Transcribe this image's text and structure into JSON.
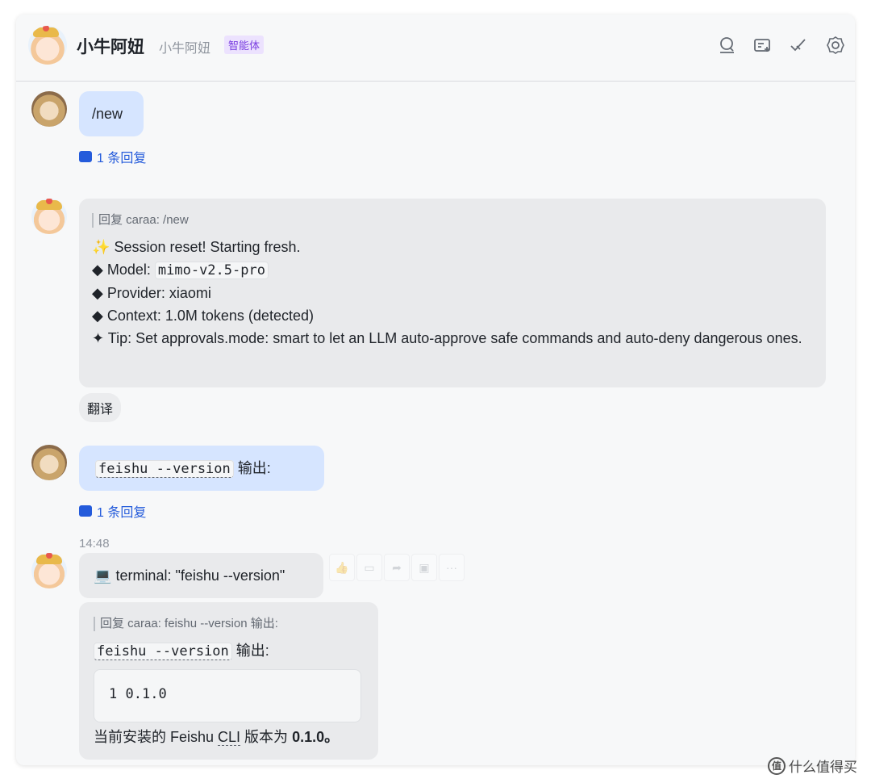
{
  "header": {
    "title": "小牛阿妞",
    "subtitle": "小牛阿妞",
    "badge": "智能体",
    "icons": [
      "search-icon",
      "add-tab-icon",
      "checkmark-icon",
      "gear-icon"
    ]
  },
  "messages": {
    "m1": {
      "text": "/new",
      "reply_count_label": "1 条回复"
    },
    "m2": {
      "quote": "回复 caraa:  /new",
      "line1_emoji": "✨",
      "line1": "Session reset! Starting fresh.",
      "model_prefix": "◆ Model:",
      "model_value": "mimo-v2.5-pro",
      "provider": "◆ Provider: xiaomi",
      "context": "◆ Context: 1.0M tokens (detected)",
      "tip": "✦ Tip: Set approvals.mode: smart to let an LLM auto-approve safe commands and auto-deny dangerous ones.",
      "translate_label": "翻译"
    },
    "m3": {
      "code": "feishu --version",
      "suffix": "输出:",
      "reply_count_label": "1 条回复"
    },
    "m4": {
      "time": "14:48",
      "emoji": "💻",
      "text": "terminal: \"feishu --version\"",
      "quote": "回复 caraa:  feishu --version 输出:",
      "code": "feishu --version",
      "code_suffix": "输出:",
      "codeblock_line_no": "1",
      "codeblock_value": "0.1.0",
      "result_prefix": "当前安装的 Feishu ",
      "result_cli": "CLI",
      "result_mid": " 版本为 ",
      "result_version": "0.1.0",
      "result_end": "。"
    }
  },
  "toolbar": {
    "icons": [
      "thumbs-up-icon",
      "comment-icon",
      "forward-icon",
      "more-box-icon",
      "ellipsis-icon"
    ],
    "ellipsis": "···"
  },
  "watermark": {
    "logo_text": "值",
    "text": "什么值得买"
  }
}
